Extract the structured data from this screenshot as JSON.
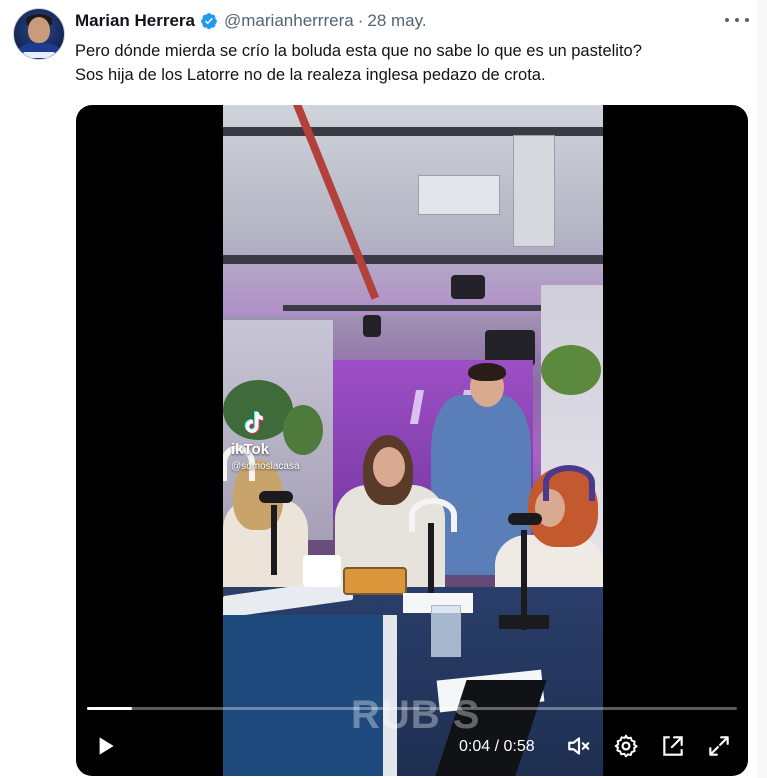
{
  "author": {
    "name": "Marian Herrera",
    "handle": "@marianherrrera",
    "separator": "·",
    "date": "28 may."
  },
  "icons": {
    "avatar": "user-avatar-photo",
    "verified": "verified-badge-icon",
    "more": "more-options-icon",
    "play": "play-icon",
    "mute": "volume-muted-icon",
    "settings": "gear-icon",
    "dock": "picture-in-picture-icon",
    "fullscreen": "fullscreen-icon"
  },
  "tweet": {
    "lines": [
      "Pero dónde mierda se crío la boluda esta que no sabe lo que es un pastelito?",
      "Sos hija de los Latorre no de la realeza inglesa pedazo de crota."
    ]
  },
  "video": {
    "watermark": {
      "brand": "TikTok",
      "brand_visible": "ikTok",
      "handle": "@somoslacasa"
    },
    "overlay_text": "RUBIUS",
    "overlay_visible": "RUB  S",
    "current_time": "0:04",
    "duration": "0:58",
    "time_display": "0:04 / 0:58",
    "progress_fraction": 0.069
  },
  "colors": {
    "verified_blue": "#1d9bf0",
    "text_primary": "#0f1419",
    "text_secondary": "#536471",
    "video_bg": "#000000"
  }
}
